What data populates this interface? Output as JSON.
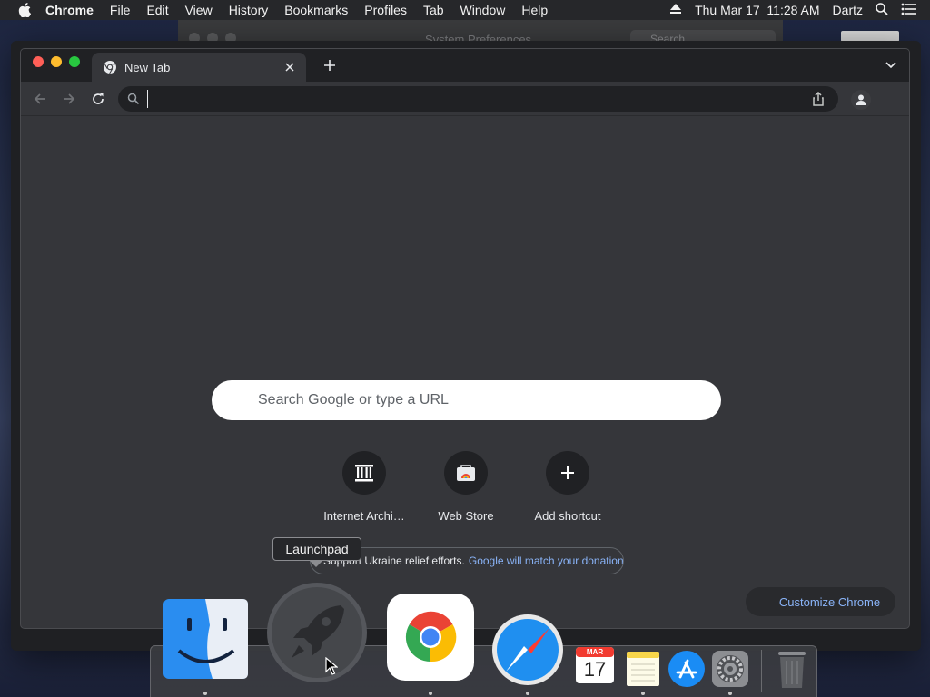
{
  "menubar": {
    "app_name": "Chrome",
    "items": [
      "File",
      "Edit",
      "View",
      "History",
      "Bookmarks",
      "Profiles",
      "Tab",
      "Window",
      "Help"
    ],
    "clock": "Thu Mar 17  11:28 AM",
    "user": "Dartz"
  },
  "background_window": {
    "title": "System Preferences",
    "search_placeholder": "Search"
  },
  "browser": {
    "tab_title": "New Tab",
    "omnibox_value": "",
    "ntp": {
      "search_placeholder": "Search Google or type a URL",
      "shortcuts": [
        {
          "label": "Internet Archi…",
          "icon": "archive-icon"
        },
        {
          "label": "Web Store",
          "icon": "web-store-icon"
        },
        {
          "label": "Add shortcut",
          "icon": "plus-icon"
        }
      ],
      "promo_text": "Support Ukraine relief efforts.",
      "promo_link": "Google will match your donation",
      "customize_label": "Customize Chrome"
    }
  },
  "tooltip": {
    "text": "Launchpad"
  },
  "dock": {
    "items": [
      {
        "name": "Finder",
        "icon": "finder-icon",
        "running": true
      },
      {
        "name": "Launchpad",
        "icon": "launchpad-icon",
        "running": false
      },
      {
        "name": "Google Chrome",
        "icon": "chrome-icon",
        "running": true
      },
      {
        "name": "Safari",
        "icon": "safari-icon",
        "running": true
      },
      {
        "name": "Calendar",
        "icon": "calendar-icon",
        "running": false,
        "month": "MAR",
        "day": "17"
      },
      {
        "name": "Notes",
        "icon": "notes-icon",
        "running": true
      },
      {
        "name": "App Store",
        "icon": "app-store-icon",
        "running": false
      },
      {
        "name": "System Preferences",
        "icon": "system-preferences-icon",
        "running": true
      },
      {
        "name": "Trash",
        "icon": "trash-icon",
        "running": false
      }
    ]
  },
  "colors": {
    "accent_link": "#8ab4f8",
    "close_red": "#ff5f57",
    "minimize_yellow": "#febc2e",
    "zoom_green": "#28c840"
  }
}
